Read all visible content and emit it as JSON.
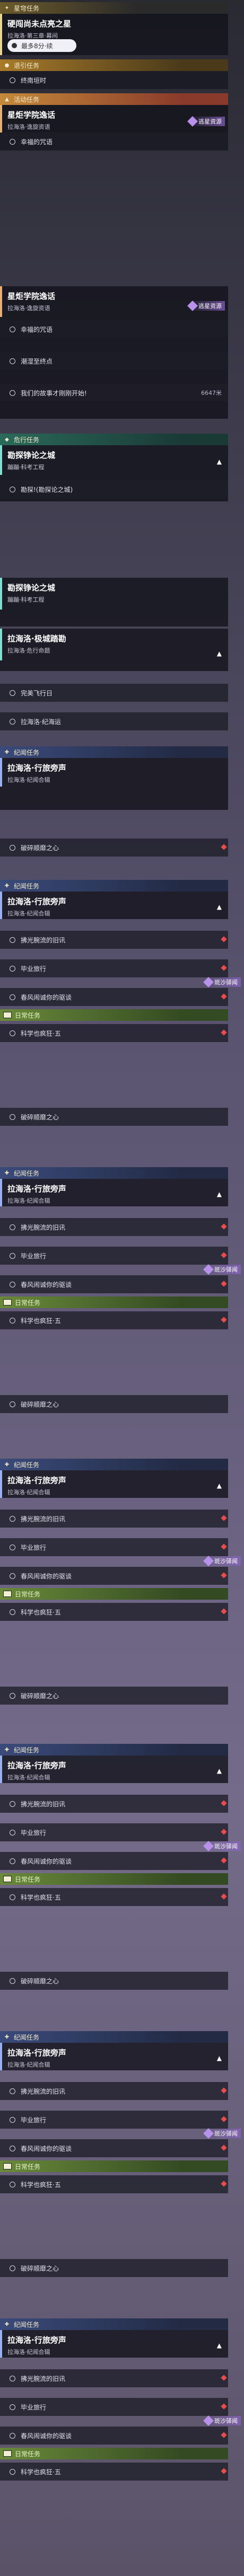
{
  "s1": {
    "tab": "星穹任务",
    "title": "硬闯尚未点亮之星",
    "subtitle": "拉海洛·第三章·幕间",
    "pill": "最多8分·续",
    "guide_header": "退引任务",
    "guide_item": "终南垣时",
    "event_header": "活动任务",
    "event_title": "星炬学院逸话",
    "event_sub": "拉海洛·逸旋资语",
    "event_item": "幸福的咒语",
    "badge": "逃星资源"
  },
  "s2": {
    "title": "星炬学院逸话",
    "sub": "拉海洛·逸旋资语",
    "badge": "逃星资源",
    "items": [
      "幸福的咒语",
      "潮湿至终点",
      "我们的故事才刚刚开始!"
    ],
    "dist": "6647米"
  },
  "s3": {
    "header": "危行任务",
    "title": "勘探铮论之城",
    "sub": "蹦蹦·科考工程",
    "item": "勘探!(勘探论之城)"
  },
  "s4": {
    "title": "勘探铮论之城",
    "sub": "蹦蹦·科考工程",
    "t2": "拉海洛·极城踏勘",
    "s2": "拉海洛·危行命题",
    "items": [
      "完美飞行日",
      "拉海洛·纪海运"
    ],
    "journey_header": "纪闻任务",
    "j_title": "拉海洛·行旅旁声",
    "j_sub": "拉海洛·纪闻合辑",
    "j_item": "破碎顺靡之心"
  },
  "journey": {
    "header": "纪闻任务",
    "title": "拉海洛·行旅旁声",
    "sub": "拉海洛·纪闻合辑",
    "items": [
      "拂光腕流的旧讯",
      "毕业旅行",
      "春风闹诚你的驱谈"
    ],
    "badge": "斑沙驿闻",
    "daily_header": "日常任务",
    "daily_item": "科学也疯狂·五",
    "extra": "破碎顺靡之心"
  }
}
